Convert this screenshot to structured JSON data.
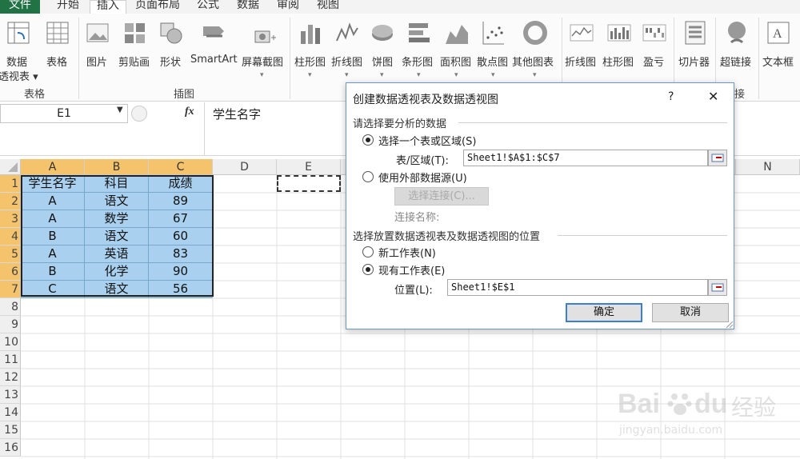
{
  "menu_tabs": [
    "文件",
    "开始",
    "插入",
    "页面布局",
    "公式",
    "数据",
    "审阅",
    "视图"
  ],
  "ribbon": {
    "buttons": [
      {
        "id": "pivot",
        "label": "数据",
        "sub": "透视表 ▾",
        "icon": "pivot-table-icon"
      },
      {
        "id": "table",
        "label": "表格",
        "icon": "table-icon"
      },
      {
        "id": "picture",
        "label": "图片",
        "icon": "picture-icon"
      },
      {
        "id": "clipart",
        "label": "剪贴画",
        "icon": "clipart-icon"
      },
      {
        "id": "shapes",
        "label": "形状",
        "icon": "shapes-icon"
      },
      {
        "id": "smartart",
        "label": "SmartArt",
        "icon": "smartart-icon"
      },
      {
        "id": "screenshot",
        "label": "屏幕截图",
        "icon": "screenshot-icon"
      },
      {
        "id": "column",
        "label": "柱形图",
        "icon": "column-chart-icon"
      },
      {
        "id": "line",
        "label": "折线图",
        "icon": "line-chart-icon"
      },
      {
        "id": "pie",
        "label": "饼图",
        "icon": "pie-chart-icon"
      },
      {
        "id": "bar",
        "label": "条形图",
        "icon": "bar-chart-icon"
      },
      {
        "id": "area",
        "label": "面积图",
        "icon": "area-chart-icon"
      },
      {
        "id": "scatter",
        "label": "散点图",
        "icon": "scatter-chart-icon"
      },
      {
        "id": "other",
        "label": "其他图表",
        "icon": "other-chart-icon"
      },
      {
        "id": "spark_line",
        "label": "折线图",
        "icon": "sparkline-line-icon"
      },
      {
        "id": "spark_column",
        "label": "柱形图",
        "icon": "sparkline-column-icon"
      },
      {
        "id": "winloss",
        "label": "盈亏",
        "icon": "winloss-icon"
      },
      {
        "id": "slicer",
        "label": "切片器",
        "icon": "slicer-icon"
      },
      {
        "id": "hyperlink",
        "label": "超链接",
        "icon": "hyperlink-icon"
      },
      {
        "id": "textbox",
        "label": "文本框",
        "icon": "textbox-icon"
      }
    ],
    "groups": [
      "表格",
      "插图",
      "接"
    ]
  },
  "formula_bar": {
    "name_box": "E1",
    "fx": "fx",
    "value": "学生名字"
  },
  "columns": [
    "A",
    "B",
    "C",
    "D",
    "E",
    "N"
  ],
  "rows": [
    "1",
    "2",
    "3",
    "4",
    "5",
    "6",
    "7",
    "8",
    "9",
    "10",
    "11",
    "12",
    "13",
    "14",
    "15",
    "16"
  ],
  "table": {
    "headers": [
      "学生名字",
      "科目",
      "成绩"
    ],
    "rows": [
      [
        "A",
        "语文",
        "89"
      ],
      [
        "A",
        "数学",
        "67"
      ],
      [
        "B",
        "语文",
        "60"
      ],
      [
        "A",
        "英语",
        "83"
      ],
      [
        "B",
        "化学",
        "90"
      ],
      [
        "C",
        "语文",
        "56"
      ]
    ]
  },
  "dialog": {
    "title": "创建数据透视表及数据透视图",
    "help": "?",
    "close": "✕",
    "section1": "请选择要分析的数据",
    "opt_select_range": "选择一个表或区域(S)",
    "range_label": "表/区域(T):",
    "range_value": "Sheet1!$A$1:$C$7",
    "opt_external": "使用外部数据源(U)",
    "choose_connection": "选择连接(C)...",
    "connection_name_label": "连接名称:",
    "section2": "选择放置数据透视表及数据透视图的位置",
    "opt_new_sheet": "新工作表(N)",
    "opt_existing_sheet": "现有工作表(E)",
    "location_label": "位置(L):",
    "location_value": "Sheet1!$E$1",
    "ok": "确定",
    "cancel": "取消"
  },
  "watermark": {
    "brand": "Bai",
    "brand2": "du",
    "cn": "经验",
    "url": "jingyan.baidu.com"
  },
  "colors": {
    "selection": "#a9d1ef",
    "header_selected": "#f4c36b",
    "file_tab": "#217346",
    "dialog_border": "#6d97c9"
  }
}
